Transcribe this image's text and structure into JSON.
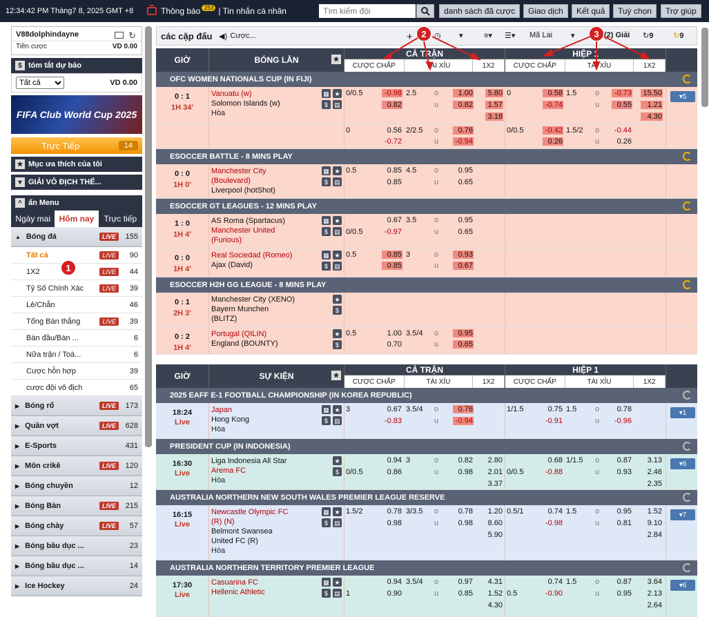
{
  "topbar": {
    "clock": "12:34:42 PM Tháng7 8, 2025 GMT +8",
    "notice": "Thông báo",
    "notice_count": "253",
    "inbox": "| Tin nhắn cá nhân",
    "search_placeholder": "Tìm kiếm đội",
    "buttons": [
      "danh sách đã cược",
      "Giao dịch",
      "Kết quả",
      "Tuỳ chọn",
      "Trợ giúp"
    ]
  },
  "left": {
    "username": "V88dolphindayne",
    "balance_label": "Tiền cược",
    "balance_value": "VD  0.00",
    "summary_title": "tóm tắt dự báo",
    "summary_select": "Tất cả",
    "summary_value": "VD 0.00",
    "banner_text": "FIFA Club World Cup 2025",
    "live_label": "Trực Tiếp",
    "live_count": "14",
    "favorites": "Mục ưa thích của tôi",
    "league": "GIẢI VÔ ĐỊCH THẾ...",
    "menu": "ẩn Menu",
    "tabs": [
      "Ngày mai",
      "Hôm nay",
      "Trực tiếp"
    ],
    "football": {
      "name": "Bóng đá",
      "count": "155"
    },
    "subs": [
      {
        "name": "Tất cả",
        "live": true,
        "count": "90"
      },
      {
        "name": "1X2",
        "live": true,
        "count": "44"
      },
      {
        "name": "Tỷ Số Chính Xác",
        "live": true,
        "count": "39"
      },
      {
        "name": "Lẻ/Chẵn",
        "live": false,
        "count": "46"
      },
      {
        "name": "Tổng Bàn thắng",
        "live": true,
        "count": "39"
      },
      {
        "name": "Bàn đầu/Bàn ...",
        "live": false,
        "count": "6"
      },
      {
        "name": "Nữa trận / Toà...",
        "live": false,
        "count": "6"
      },
      {
        "name": "Cược hỗn hợp",
        "live": false,
        "count": "39"
      },
      {
        "name": "cược đội vô địch",
        "live": false,
        "count": "65"
      }
    ],
    "sports": [
      {
        "name": "Bóng rổ",
        "live": true,
        "count": "173"
      },
      {
        "name": "Quần vợt",
        "live": true,
        "count": "628"
      },
      {
        "name": "E-Sports",
        "live": false,
        "count": "431"
      },
      {
        "name": "Môn crikê",
        "live": true,
        "count": "120"
      },
      {
        "name": "Bóng chuyền",
        "live": false,
        "count": "12"
      },
      {
        "name": "Bóng Bàn",
        "live": true,
        "count": "215"
      },
      {
        "name": "Bóng chày",
        "live": true,
        "count": "57"
      },
      {
        "name": "Bóng bầu dục ...",
        "live": false,
        "count": "23"
      },
      {
        "name": "Bóng bầu dục ...",
        "live": false,
        "count": "14"
      },
      {
        "name": "Ice Hockey",
        "live": false,
        "count": "24"
      }
    ],
    "live_tag": "LIVE"
  },
  "toolbar": {
    "title": "các cặp đấu",
    "bet": "Cược...",
    "odds": "Mã Lai",
    "leagues": "(2) Giải",
    "r1": "9",
    "r2": "9"
  },
  "header1": {
    "time": "GIỜ",
    "team": "BÓNG LĂN",
    "full": "CẢ TRẬN",
    "half": "HIỆP 1",
    "sub": [
      "CƯỢC CHẤP",
      "TÀI XỈU",
      "1X2"
    ]
  },
  "header2": {
    "time": "GIỜ",
    "team": "SỰ KIỆN",
    "full": "CẢ TRẬN",
    "half": "HIỆP 1",
    "sub": [
      "CƯỢC CHẤP",
      "TÀI XỈU",
      "1X2"
    ]
  },
  "leagues": {
    "ofc": "OFC WOMEN NATIONALS CUP (IN FIJI)",
    "battle": "ESOCCER BATTLE - 8 MINS PLAY",
    "gt": "ESOCCER GT LEAGUES - 12 MINS PLAY",
    "h2h": "ESOCCER H2H GG LEAGUE - 8 MINS PLAY",
    "eaff": "2025 EAFF E-1 FOOTBALL CHAMPIONSHIP (IN KOREA REPUBLIC)",
    "pres": "PRESIDENT CUP (IN INDONESIA)",
    "ausnsw": "AUSTRALIA NORTHERN NEW SOUTH WALES PREMIER LEAGUE RESERVE",
    "ausnt": "AUSTRALIA NORTHERN TERRITORY PREMIER LEAGUE"
  },
  "m1": {
    "score": "0 : 1",
    "period": "1H 34'",
    "t1": "Vanuatu (w)",
    "t2": "Solomon Islands (w)",
    "draw": "Hòa",
    "more": "5",
    "a": [
      "0/0.5",
      "-0.98",
      "0.82",
      "2.5",
      "o",
      "u",
      "1.00",
      "0.82",
      "5.80",
      "1.57",
      "3.18",
      "0",
      "0.58",
      "-0.74",
      "1.5",
      "o",
      "u",
      "-0.73",
      "0.55",
      "15.50",
      "1.21",
      "4.30"
    ],
    "b": [
      "0",
      "0.56",
      "-0.72",
      "2/2.5",
      "o",
      "u",
      "0.76",
      "-0.94",
      "0/0.5",
      "-0.42",
      "0.26",
      "1.5/2",
      "o",
      "u",
      "-0.44",
      "0.26"
    ]
  },
  "m2": {
    "score": "0 : 0",
    "period": "1H 0'",
    "t1": "Manchester City",
    "t1b": "(Boulevard)",
    "t2": "Liverpool (hotShot)",
    "a": [
      "0.5",
      "0.85",
      "0.85",
      "4.5",
      "o",
      "u",
      "0.95",
      "0.65"
    ]
  },
  "m3": {
    "score": "1 : 0",
    "period": "1H 4'",
    "t1": "AS Roma (Spartacus)",
    "t2": "Manchester United",
    "t2b": "(Furious)",
    "a": [
      "0.67",
      "-0.97",
      "0/0.5",
      "3.5",
      "o",
      "u",
      "0.95",
      "0.65"
    ]
  },
  "m4": {
    "score": "0 : 0",
    "period": "1H 4'",
    "t1": "Real Sociedad (Romeo)",
    "t2": "Ajax (David)",
    "a": [
      "0.5",
      "0.85",
      "0.85",
      "3",
      "o",
      "u",
      "0.93",
      "0.67"
    ]
  },
  "m5": {
    "score": "0 : 1",
    "period": "2H 3'",
    "t1": "Manchester City (XENO)",
    "t2": "Bayern Munchen",
    "t2b": "(BLITZ)"
  },
  "m6": {
    "score": "0 : 2",
    "period": "1H 4'",
    "t1": "Portugal (QILIN)",
    "t2": "England (BOUNTY)",
    "a": [
      "0.5",
      "1.00",
      "0.70",
      "3.5/4",
      "o",
      "u",
      "0.95",
      "0.65"
    ]
  },
  "e1": {
    "time": "18:24",
    "live": "Live",
    "t1": "Japan",
    "t2": "Hong Kong",
    "draw": "Hòa",
    "more": "1",
    "a": [
      "3",
      "0.67",
      "-0.83",
      "3.5/4",
      "o",
      "u",
      "0.76",
      "-0.94",
      "1/1.5",
      "0.75",
      "-0.91",
      "1.5",
      "o",
      "u",
      "0.78",
      "-0.96"
    ]
  },
  "e2": {
    "time": "16:30",
    "live": "Live",
    "t1": "Liga Indonesia All Star",
    "t2": "Arema FC",
    "draw": "Hòa",
    "more": "6",
    "a": [
      "0.94",
      "0/0.5",
      "0.86",
      "3",
      "o",
      "u",
      "0.82",
      "0.98",
      "2.80",
      "2.01",
      "3.37",
      "0.68",
      "0/0.5",
      "-0.88",
      "1/1.5",
      "o",
      "u",
      "0.87",
      "0.93",
      "3.13",
      "2.46",
      "2.35"
    ]
  },
  "e3": {
    "time": "16:15",
    "live": "Live",
    "t1": "Newcastle Olympic FC",
    "t1b": "(R) (N)",
    "t2": "Belmont Swansea",
    "t2b": "United FC (R)",
    "draw": "Hòa",
    "more": "7",
    "a": [
      "1.5/2",
      "0.78",
      "0.98",
      "3/3.5",
      "o",
      "u",
      "0.78",
      "0.98",
      "1.20",
      "8.60",
      "5.90",
      "0.5/1",
      "0.74",
      "-0.98",
      "1.5",
      "o",
      "u",
      "0.95",
      "0.81",
      "1.52",
      "9.10",
      "2.84"
    ]
  },
  "e4": {
    "time": "17:30",
    "live": "Live",
    "t1": "Casuarina FC",
    "t2": "Hellenic Athletic",
    "more": "6",
    "a": [
      "0.94",
      "1",
      "0.90",
      "3.5/4",
      "o",
      "u",
      "0.97",
      "0.85",
      "4.31",
      "1.52",
      "4.30",
      "0.74",
      "0.5",
      "-0.90",
      "1.5",
      "o",
      "u",
      "0.87",
      "0.95",
      "3.64",
      "2.13",
      "2.64"
    ]
  },
  "annotations": [
    "1",
    "2",
    "3"
  ],
  "colors": {
    "accent": "#c0392b",
    "header": "#3a4252",
    "live_row": "#fbd7cc",
    "highlight": "#f08a80"
  }
}
